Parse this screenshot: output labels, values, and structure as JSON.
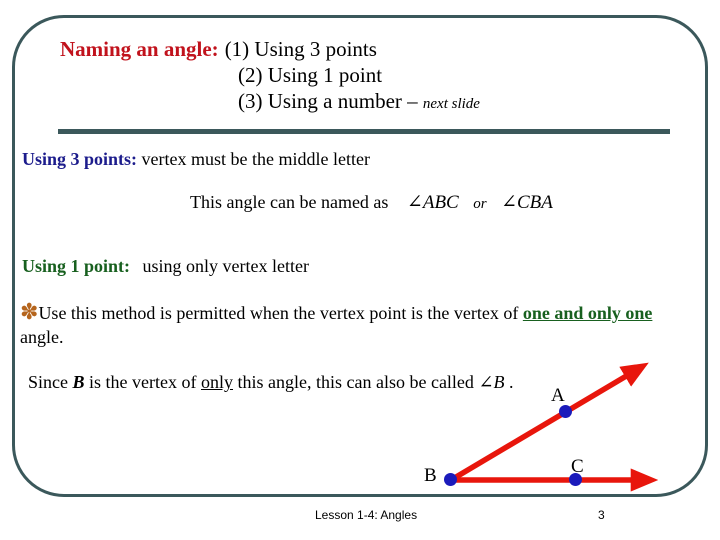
{
  "slide": {
    "frame_color": "#3b585b",
    "background": "#ffffff"
  },
  "title": {
    "label": "Naming an angle:",
    "label_color": "#c1121c",
    "lines": [
      "(1) Using 3 points",
      "(2) Using 1 point",
      "(3) Using a number"
    ],
    "suffix_dash": "–",
    "suffix_note": "next slide"
  },
  "body": {
    "three_points": {
      "heading": "Using 3 points:",
      "heading_color": "#1c1c8c",
      "text": "vertex must be the middle letter"
    },
    "named_as": {
      "text": "This angle can be named as",
      "expr_1": "∠ABC",
      "conjunction": "or",
      "expr_2": "∠CBA"
    },
    "one_point": {
      "heading": "Using 1 point:",
      "heading_color": "#18601f",
      "text": "using only vertex letter"
    },
    "note": {
      "asterisk": "✽",
      "asterisk_color": "#b5651d",
      "part_1": "Use this method is permitted when the vertex point is the vertex of ",
      "emphasis": "one and only one",
      "emphasis_color": "#18601f",
      "part_2": " angle."
    },
    "since": {
      "part_1": "Since ",
      "var_b": "B",
      "part_2": " is the vertex of ",
      "underlined": "only",
      "part_3": " this angle, this can also be called ",
      "expr": "∠B",
      "part_4": " ."
    }
  },
  "figure": {
    "ray_color": "#e8160c",
    "point_color": "#1b1bbb",
    "points": [
      {
        "name": "A",
        "label": "A"
      },
      {
        "name": "B",
        "label": "B"
      },
      {
        "name": "C",
        "label": "C"
      }
    ]
  },
  "footer": {
    "lesson": "Lesson 1-4: Angles",
    "page": "3"
  }
}
